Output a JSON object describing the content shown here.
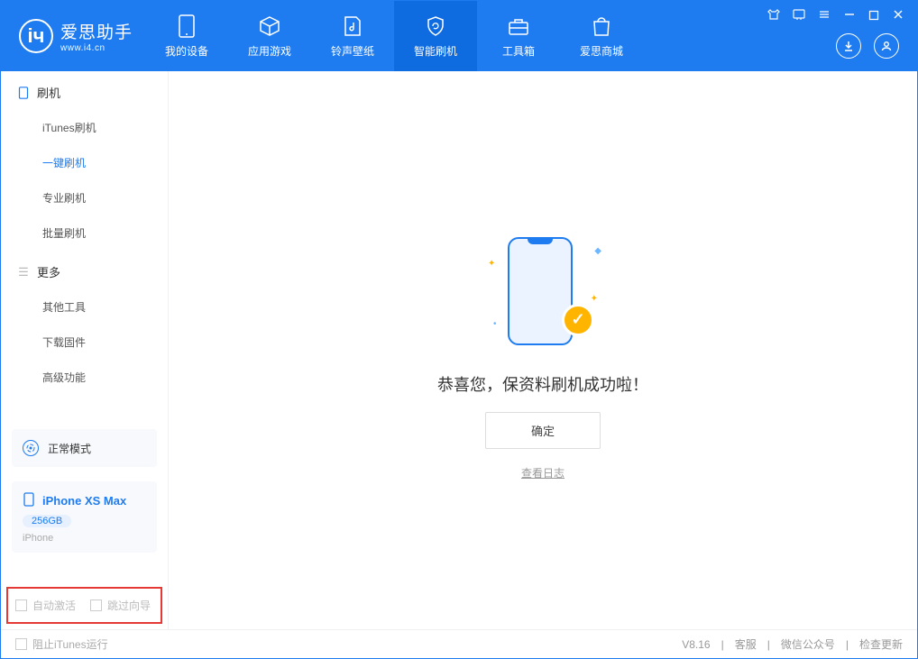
{
  "app": {
    "name": "爱思助手",
    "domain": "www.i4.cn"
  },
  "nav": {
    "items": [
      {
        "label": "我的设备"
      },
      {
        "label": "应用游戏"
      },
      {
        "label": "铃声壁纸"
      },
      {
        "label": "智能刷机"
      },
      {
        "label": "工具箱"
      },
      {
        "label": "爱思商城"
      }
    ]
  },
  "sidebar": {
    "section1": "刷机",
    "items1": [
      {
        "label": "iTunes刷机"
      },
      {
        "label": "一键刷机"
      },
      {
        "label": "专业刷机"
      },
      {
        "label": "批量刷机"
      }
    ],
    "section2": "更多",
    "items2": [
      {
        "label": "其他工具"
      },
      {
        "label": "下载固件"
      },
      {
        "label": "高级功能"
      }
    ]
  },
  "mode": {
    "label": "正常模式"
  },
  "device": {
    "name": "iPhone XS Max",
    "capacity": "256GB",
    "type": "iPhone"
  },
  "options": {
    "auto_activate": "自动激活",
    "skip_guide": "跳过向导"
  },
  "main": {
    "success_msg": "恭喜您，保资料刷机成功啦！",
    "ok_btn": "确定",
    "view_log": "查看日志"
  },
  "footer": {
    "block_itunes": "阻止iTunes运行",
    "version": "V8.16",
    "support": "客服",
    "wechat": "微信公众号",
    "check_update": "检查更新"
  }
}
